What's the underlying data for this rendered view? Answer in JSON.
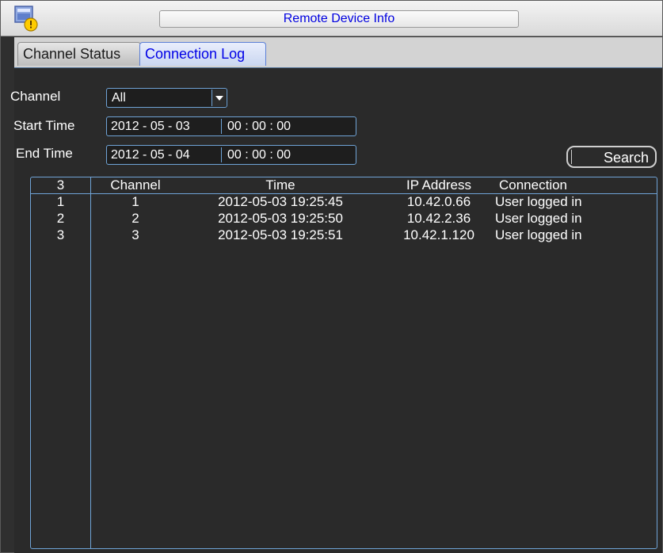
{
  "window": {
    "title": "Remote Device Info",
    "icon": "app-info-icon"
  },
  "tabs": [
    {
      "label": "Channel Status",
      "active": false
    },
    {
      "label": "Connection Log",
      "active": true
    }
  ],
  "filters": {
    "channel_label": "Channel",
    "channel_value": "All",
    "start_label": "Start Time",
    "start_date": "2012 - 05 - 03",
    "start_time": "00 : 00 : 00",
    "end_label": "End Time",
    "end_date": "2012 - 05 - 04",
    "end_time": "00 : 00 : 00",
    "search_label": "Search"
  },
  "table": {
    "headers": [
      "3",
      "Channel",
      "Time",
      "IP Address",
      "Connection"
    ],
    "rows": [
      [
        "1",
        "1",
        "2012-05-03 19:25:45",
        "10.42.0.66",
        "User logged in"
      ],
      [
        "2",
        "2",
        "2012-05-03 19:25:50",
        "10.42.2.36",
        "User logged in"
      ],
      [
        "3",
        "3",
        "2012-05-03 19:25:51",
        "10.42.1.120",
        "User logged in"
      ]
    ]
  },
  "colors": {
    "background": "#2f2f2f",
    "border_accent": "#6fa3d6",
    "title_text": "#0000e0",
    "active_tab_text": "#0000e6"
  }
}
